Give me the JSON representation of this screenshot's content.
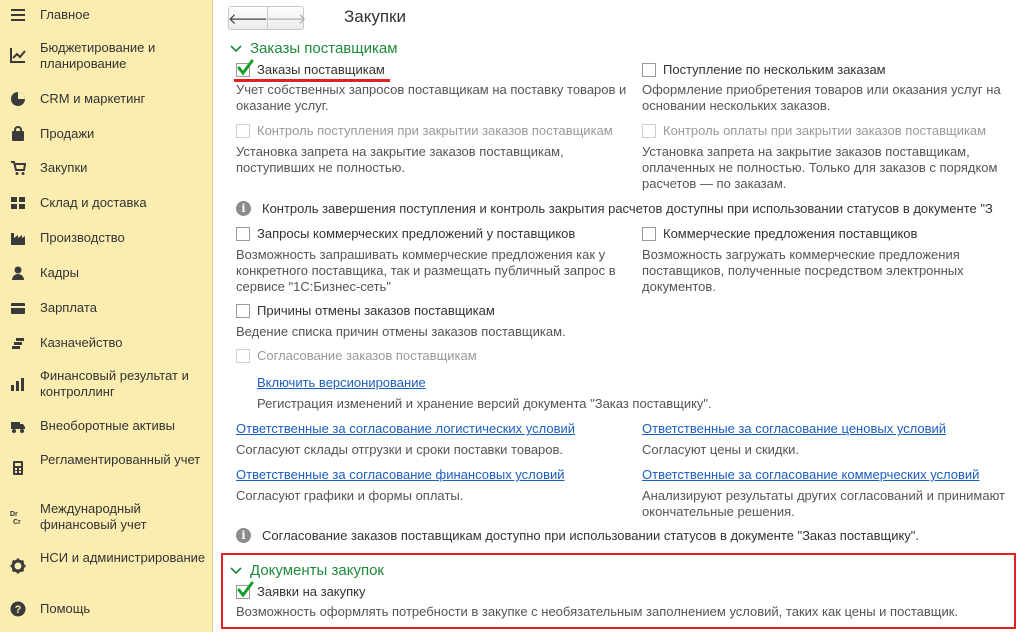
{
  "sidebar": {
    "items": [
      {
        "label": "Главное",
        "icon": "menu-lines-icon"
      },
      {
        "label": "Бюджетирование и планирование",
        "icon": "chart-line-icon"
      },
      {
        "label": "CRM и маркетинг",
        "icon": "pie-chart-icon"
      },
      {
        "label": "Продажи",
        "icon": "bag-icon"
      },
      {
        "label": "Закупки",
        "icon": "cart-icon"
      },
      {
        "label": "Склад и доставка",
        "icon": "grid-icon"
      },
      {
        "label": "Производство",
        "icon": "factory-icon"
      },
      {
        "label": "Кадры",
        "icon": "person-icon"
      },
      {
        "label": "Зарплата",
        "icon": "wallet-icon"
      },
      {
        "label": "Казначейство",
        "icon": "coins-icon"
      },
      {
        "label": "Финансовый результат и контроллинг",
        "icon": "bar-chart-icon"
      },
      {
        "label": "Внеоборотные активы",
        "icon": "truck-icon"
      },
      {
        "label": "Регламентированный учет",
        "icon": "calculator-icon"
      },
      {
        "label": "Международный финансовый учет",
        "icon": "dr-cr-icon"
      },
      {
        "label": "НСИ и администрирование",
        "icon": "gear-icon"
      },
      {
        "label": "Помощь",
        "icon": "help-icon"
      }
    ],
    "drcr_top": "Dr",
    "drcr_bottom": "Cr"
  },
  "header": {
    "back": "🡐",
    "forward": "🡒",
    "title": "Закупки"
  },
  "sections": {
    "orders": {
      "title": "Заказы поставщикам",
      "supplier_orders": {
        "label": "Заказы поставщикам",
        "checked": true,
        "desc": "Учет собственных запросов поставщикам на поставку товаров и оказание услуг."
      },
      "multi_orders": {
        "label": "Поступление по нескольким заказам",
        "checked": false,
        "desc": "Оформление приобретения товаров или оказания услуг на основании нескольких заказов."
      },
      "receipt_control": {
        "label": "Контроль поступления при закрытии заказов поставщикам",
        "checked": false,
        "disabled": true,
        "desc": "Установка запрета на закрытие заказов поставщикам, поступивших не полностью."
      },
      "payment_control": {
        "label": "Контроль оплаты при закрытии заказов поставщикам",
        "checked": false,
        "disabled": true,
        "desc": "Установка запрета на закрытие заказов поставщикам, оплаченных не полностью. Только для заказов с порядком расчетов — по заказам."
      },
      "info_statuses": "Контроль завершения поступления и контроль закрытия расчетов доступны при использовании статусов в документе \"З",
      "quote_requests": {
        "label": "Запросы коммерческих предложений у поставщиков",
        "checked": false,
        "desc": "Возможность запрашивать коммерческие предложения как у конкретного поставщика, так и размещать публичный запрос в сервисе \"1С:Бизнес-сеть\""
      },
      "commercial_offers": {
        "label": "Коммерческие предложения поставщиков",
        "checked": false,
        "desc": "Возможность загружать коммерческие предложения поставщиков, полученные посредством электронных документов."
      },
      "cancel_reasons": {
        "label": "Причины отмены заказов поставщикам",
        "checked": false,
        "desc": "Ведение списка причин отмены заказов поставщикам."
      },
      "approval": {
        "label": "Согласование заказов поставщикам",
        "checked": false,
        "disabled": true
      },
      "versioning_link": "Включить версионирование",
      "versioning_desc": "Регистрация изменений и хранение версий документа \"Заказ поставщику\".",
      "logistics_link": "Ответственные за согласование логистических условий",
      "logistics_desc": "Согласуют склады отгрузки и сроки поставки товаров.",
      "price_link": "Ответственные за согласование ценовых условий",
      "price_desc": "Согласуют цены и скидки.",
      "finance_link": "Ответственные за согласование финансовых условий",
      "finance_desc": "Согласуют графики и формы оплаты.",
      "commercial_link": "Ответственные за согласование коммерческих условий",
      "commercial_desc": "Анализируют результаты других согласований и принимают окончательные решения.",
      "info_approval": "Согласование заказов поставщикам доступно при использовании статусов в документе \"Заказ поставщику\"."
    },
    "docs": {
      "title": "Документы закупок",
      "requests": {
        "label": "Заявки на закупку",
        "checked": true,
        "desc": "Возможность оформлять потребности в закупке с необязательным заполнением условий, таких как цены и поставщик."
      }
    }
  },
  "colors": {
    "section_title": "#1f8a3c",
    "link": "#1a5ec2",
    "highlight": "#e32020",
    "sidebar_bg": "#fbedb0"
  }
}
